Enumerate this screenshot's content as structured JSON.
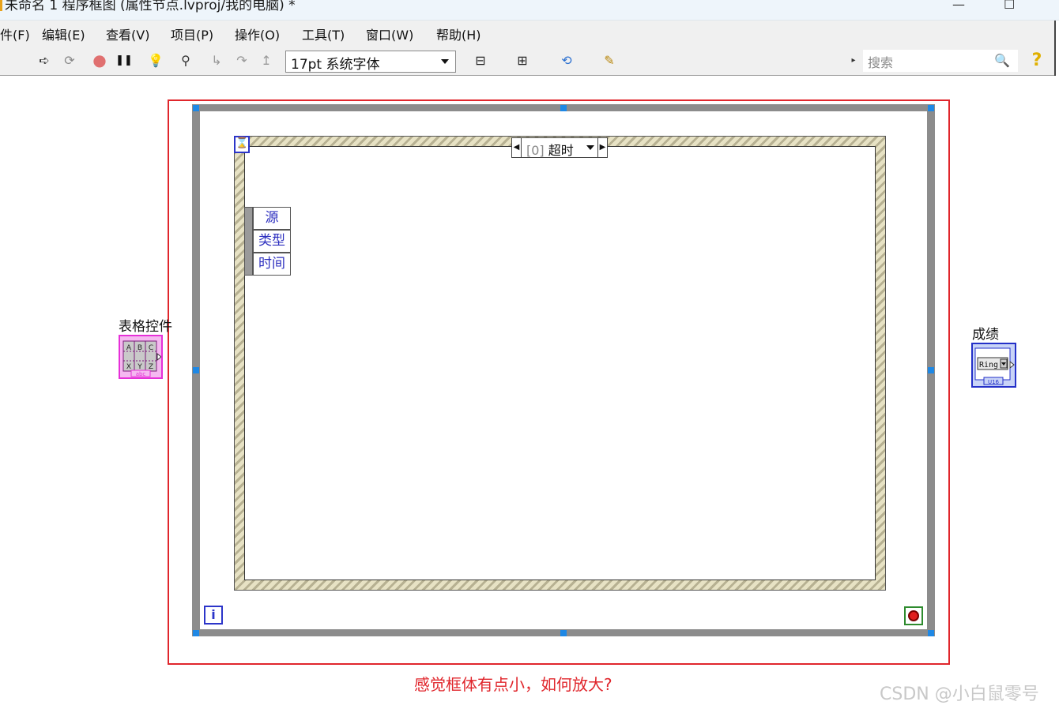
{
  "window": {
    "title": "未命名 1 程序框图 (属性节点.lvproj/我的电脑) *",
    "minimize_glyph": "—",
    "maximize_glyph": "☐"
  },
  "menubar": {
    "items": [
      {
        "label": "件(F)"
      },
      {
        "label": "编辑(E)"
      },
      {
        "label": "查看(V)"
      },
      {
        "label": "项目(P)"
      },
      {
        "label": "操作(O)"
      },
      {
        "label": "工具(T)"
      },
      {
        "label": "窗口(W)"
      },
      {
        "label": "帮助(H)"
      }
    ]
  },
  "toolbar": {
    "font_select_value": "17pt 系统字体",
    "search_placeholder": "搜索",
    "icons": {
      "run": "➪",
      "run_continuous": "⟳",
      "abort": "●",
      "pause": "❚❚",
      "highlight": "💡",
      "retain": "⚲",
      "step_into": "↳",
      "step_over": "↷",
      "step_out": "↥",
      "align": "⊟",
      "distribute": "⊞",
      "reorder": "⟲",
      "cleanup": "✎",
      "search": "🔍",
      "help": "?"
    }
  },
  "diagram": {
    "event_structure": {
      "case_index": "[0]",
      "case_name": "超时",
      "timeout_icon": "⌛",
      "event_data_items": [
        "源",
        "类型",
        "时间"
      ]
    },
    "while_loop": {
      "iteration_label": "i"
    },
    "terminals": {
      "table_control_label": "表格控件",
      "table_control_tag": "abc",
      "table_control_cells": [
        "A",
        "B",
        "C",
        "X",
        "Y",
        "Z"
      ],
      "ring_control_label": "成绩",
      "ring_control_text": "Ring",
      "ring_control_tag": "U16"
    }
  },
  "annotation": {
    "caption": "感觉框体有点小，如何放大?",
    "watermark": "CSDN @小白鼠零号",
    "highlight_color": "#e0262c"
  }
}
